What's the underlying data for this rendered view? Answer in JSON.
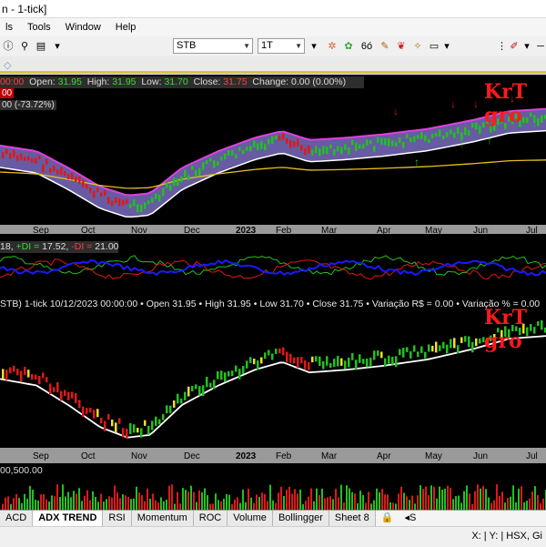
{
  "window": {
    "title": "n - 1-tick]"
  },
  "menu": [
    "ls",
    "Tools",
    "Window",
    "Help"
  ],
  "toolbar": {
    "symbol": "STB",
    "interval": "1T"
  },
  "watermark": "KrT gro",
  "price_pane": {
    "header": {
      "time": "00:00",
      "open_label": "Open:",
      "open": "31.95",
      "high_label": "High:",
      "high": "31.95",
      "low_label": "Low:",
      "low": "31.70",
      "close_label": "Close:",
      "close": "31.75",
      "change_label": "Change:",
      "change": "0.00 (0.00%)"
    },
    "sub1": "00",
    "sub2": "00 (-73.72%)",
    "months": [
      "Sep",
      "Oct",
      "Nov",
      "Dec",
      "2023",
      "Feb",
      "Mar",
      "Apr",
      "May",
      "Jun",
      "Jul"
    ]
  },
  "adx_pane": {
    "adx": "18",
    "plus_label": "+DI =",
    "plus_value": "17.52",
    "minus_label": "-DI =",
    "minus_value": "21.00"
  },
  "lower_pane": {
    "header": "STB) 1-tick  10/12/2023 00:00:00  • Open 31.95  • High 31.95  • Low 31.70  • Close 31.75  • Variação R$ = 0.00  • Variação % = 0.00",
    "months": [
      "Sep",
      "Oct",
      "Nov",
      "Dec",
      "2023",
      "Feb",
      "Mar",
      "Apr",
      "May",
      "Jun",
      "Jul"
    ]
  },
  "volume_pane": {
    "label": "00,500.00"
  },
  "tabs": [
    "ACD",
    "ADX TREND",
    "RSI",
    "Momentum",
    "ROC",
    "Volume",
    "Bollingger",
    "Sheet 8"
  ],
  "status": {
    "text": "X: | Y: | HSX, Gi"
  },
  "colors": {
    "bull": "#1fc21f",
    "bear": "#e01818",
    "neutral": "#f0e020",
    "adx_blue": "#1a1aff"
  }
}
